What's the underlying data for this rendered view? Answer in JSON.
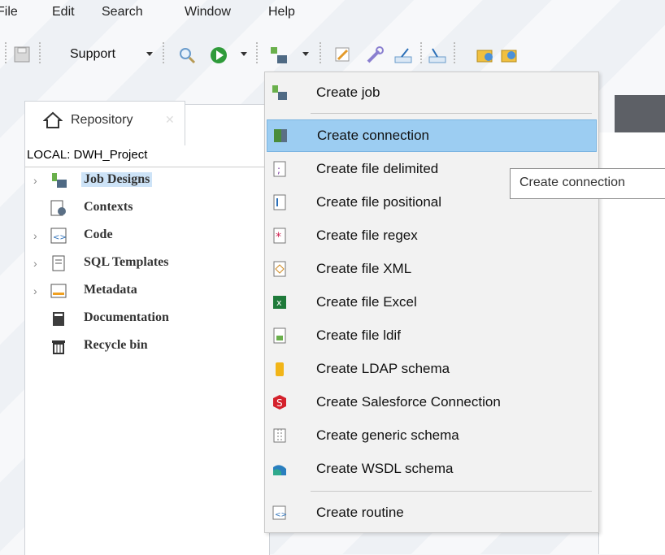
{
  "menubar": {
    "items": [
      "File",
      "Edit",
      "Search",
      "Window",
      "Help"
    ]
  },
  "toolbar": {
    "support_label": "Support"
  },
  "repository": {
    "tab_title": "Repository",
    "project": "LOCAL: DWH_Project",
    "tree": [
      {
        "label": "Job Designs",
        "icon": "job-designs-icon",
        "expandable": true,
        "selected": true
      },
      {
        "label": "Contexts",
        "icon": "contexts-icon",
        "expandable": false
      },
      {
        "label": "Code",
        "icon": "code-icon",
        "expandable": true
      },
      {
        "label": "SQL Templates",
        "icon": "sql-templates-icon",
        "expandable": true
      },
      {
        "label": "Metadata",
        "icon": "metadata-icon",
        "expandable": true
      },
      {
        "label": "Documentation",
        "icon": "documentation-icon",
        "expandable": false
      },
      {
        "label": "Recycle bin",
        "icon": "recycle-bin-icon",
        "expandable": false
      }
    ]
  },
  "context_menu": {
    "items": [
      {
        "label": "Create job",
        "icon": "create-job-icon"
      },
      {
        "label": "Create connection",
        "icon": "create-connection-icon",
        "highlighted": true
      },
      {
        "label": "Create file delimited",
        "icon": "file-delimited-icon"
      },
      {
        "label": "Create file positional",
        "icon": "file-positional-icon"
      },
      {
        "label": "Create file regex",
        "icon": "file-regex-icon"
      },
      {
        "label": "Create file XML",
        "icon": "file-xml-icon"
      },
      {
        "label": "Create file Excel",
        "icon": "file-excel-icon"
      },
      {
        "label": "Create file ldif",
        "icon": "file-ldif-icon"
      },
      {
        "label": "Create LDAP schema",
        "icon": "ldap-schema-icon"
      },
      {
        "label": "Create Salesforce Connection",
        "icon": "salesforce-icon"
      },
      {
        "label": "Create generic schema",
        "icon": "generic-schema-icon"
      },
      {
        "label": "Create WSDL schema",
        "icon": "wsdl-schema-icon"
      },
      {
        "label": "Create routine",
        "icon": "routine-icon"
      }
    ]
  },
  "tooltip": {
    "text": "Create connection"
  },
  "colors": {
    "highlight": "#9ccdf2",
    "selection": "#cde3f7",
    "dark_bar": "#5d6066"
  }
}
